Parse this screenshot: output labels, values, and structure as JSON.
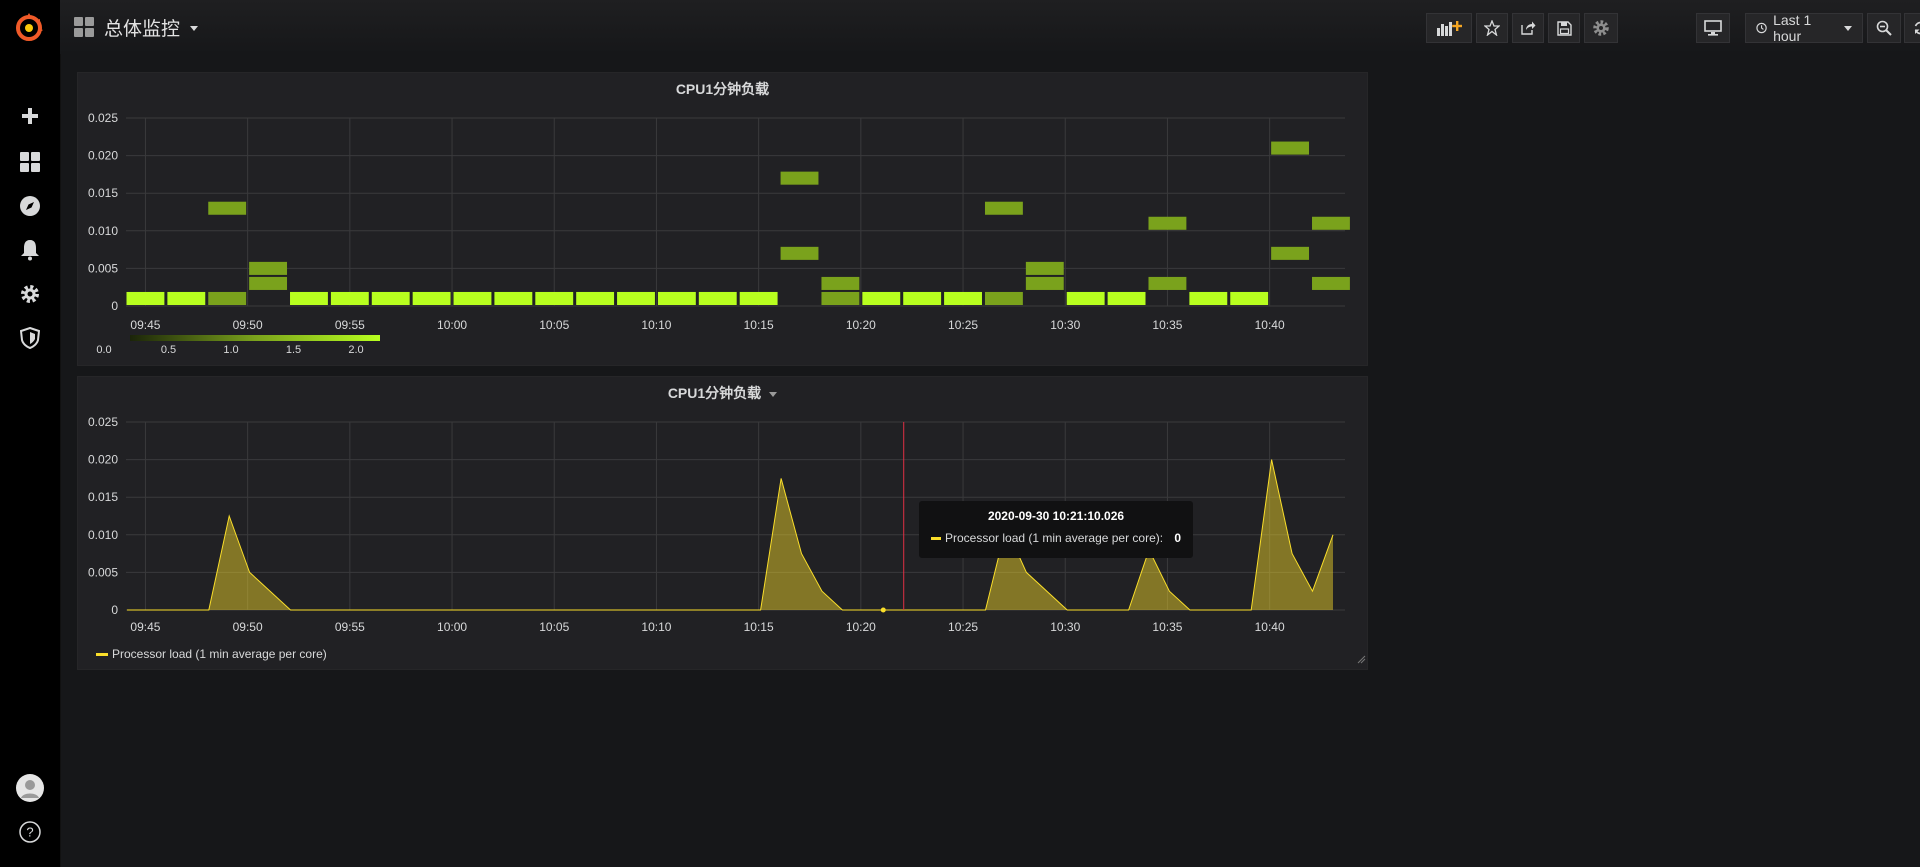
{
  "dashboard": {
    "title": "总体监控"
  },
  "navbar": {
    "time_picker_label": "Last 1 hour",
    "buttons": [
      "add-panel-icon",
      "star-icon",
      "share-icon",
      "save-icon",
      "gear-icon",
      "tv-mode-icon",
      "zoom-out-icon",
      "refresh-icon"
    ]
  },
  "sidemenu": {
    "items": [
      "grafana-logo",
      "plus-icon",
      "dashboards-icon",
      "explore-compass-icon",
      "bell-icon",
      "gear-icon",
      "shield-icon",
      "avatar",
      "help-icon"
    ]
  },
  "colors": {
    "accent": "#fade2a",
    "heat_high": "#b8ff1f",
    "heat_mid": "#7aa21c",
    "heat_low": "#57731e",
    "panel_bg": "#212124",
    "page_bg": "#161719"
  },
  "panels": [
    {
      "title": "CPU1分钟负载"
    },
    {
      "title": "CPU1分钟负载",
      "legend": "Processor load (1 min average per core)"
    }
  ],
  "tooltip": {
    "time": "2020-09-30 10:21:10.026",
    "series": "Processor load (1 min average per core):",
    "value": "0"
  },
  "chart_data": [
    {
      "type": "heatmap",
      "title": "CPU1分钟负载",
      "x_ticks": [
        "09:45",
        "09:50",
        "09:55",
        "10:00",
        "10:05",
        "10:10",
        "10:15",
        "10:20",
        "10:25",
        "10:30",
        "10:35",
        "10:40"
      ],
      "y_ticks": [
        "0.025",
        "0.020",
        "0.015",
        "0.010",
        "0.005",
        "0"
      ],
      "ylim": [
        0,
        0.025
      ],
      "bucket_size": 0.002,
      "legend_ticks": [
        "0.0",
        "0.5",
        "1.0",
        "1.5",
        "2.0"
      ],
      "color_range": [
        0,
        2
      ],
      "cells": [
        {
          "t": "09:44",
          "y": 0.001,
          "count": 2
        },
        {
          "t": "09:46",
          "y": 0.001,
          "count": 2
        },
        {
          "t": "09:48",
          "y": 0.001,
          "count": 1
        },
        {
          "t": "09:48",
          "y": 0.013,
          "count": 1
        },
        {
          "t": "09:50",
          "y": 0.003,
          "count": 1
        },
        {
          "t": "09:50",
          "y": 0.005,
          "count": 1
        },
        {
          "t": "09:52",
          "y": 0.001,
          "count": 2
        },
        {
          "t": "09:54",
          "y": 0.001,
          "count": 2
        },
        {
          "t": "09:56",
          "y": 0.001,
          "count": 2
        },
        {
          "t": "09:58",
          "y": 0.001,
          "count": 2
        },
        {
          "t": "10:00",
          "y": 0.001,
          "count": 2
        },
        {
          "t": "10:02",
          "y": 0.001,
          "count": 2
        },
        {
          "t": "10:04",
          "y": 0.001,
          "count": 2
        },
        {
          "t": "10:06",
          "y": 0.001,
          "count": 2
        },
        {
          "t": "10:08",
          "y": 0.001,
          "count": 2
        },
        {
          "t": "10:10",
          "y": 0.001,
          "count": 2
        },
        {
          "t": "10:12",
          "y": 0.001,
          "count": 2
        },
        {
          "t": "10:14",
          "y": 0.001,
          "count": 2
        },
        {
          "t": "10:16",
          "y": 0.007,
          "count": 1
        },
        {
          "t": "10:16",
          "y": 0.017,
          "count": 1
        },
        {
          "t": "10:18",
          "y": 0.001,
          "count": 1
        },
        {
          "t": "10:18",
          "y": 0.003,
          "count": 1
        },
        {
          "t": "10:20",
          "y": 0.001,
          "count": 2
        },
        {
          "t": "10:22",
          "y": 0.001,
          "count": 2
        },
        {
          "t": "10:24",
          "y": 0.001,
          "count": 2
        },
        {
          "t": "10:26",
          "y": 0.001,
          "count": 1
        },
        {
          "t": "10:26",
          "y": 0.013,
          "count": 1
        },
        {
          "t": "10:28",
          "y": 0.003,
          "count": 1
        },
        {
          "t": "10:28",
          "y": 0.005,
          "count": 1
        },
        {
          "t": "10:30",
          "y": 0.001,
          "count": 2
        },
        {
          "t": "10:32",
          "y": 0.001,
          "count": 2
        },
        {
          "t": "10:34",
          "y": 0.003,
          "count": 1
        },
        {
          "t": "10:34",
          "y": 0.011,
          "count": 1
        },
        {
          "t": "10:36",
          "y": 0.001,
          "count": 2
        },
        {
          "t": "10:38",
          "y": 0.001,
          "count": 2
        },
        {
          "t": "10:40",
          "y": 0.007,
          "count": 1
        },
        {
          "t": "10:40",
          "y": 0.021,
          "count": 1
        },
        {
          "t": "10:42",
          "y": 0.003,
          "count": 1
        },
        {
          "t": "10:42",
          "y": 0.011,
          "count": 1
        }
      ]
    },
    {
      "type": "area",
      "title": "CPU1分钟负载",
      "x_ticks": [
        "09:45",
        "09:50",
        "09:55",
        "10:00",
        "10:05",
        "10:10",
        "10:15",
        "10:20",
        "10:25",
        "10:30",
        "10:35",
        "10:40"
      ],
      "y_ticks": [
        "0.025",
        "0.020",
        "0.015",
        "0.010",
        "0.005",
        "0"
      ],
      "ylim": [
        0,
        0.025
      ],
      "grid": true,
      "legend_placement": "bottom-left",
      "series": [
        {
          "name": "Processor load (1 min average per core)",
          "x": [
            "09:44",
            "09:48",
            "09:49",
            "09:50",
            "09:52",
            "10:15",
            "10:16",
            "10:17",
            "10:18",
            "10:19",
            "10:20",
            "10:21",
            "10:25",
            "10:26",
            "10:27",
            "10:28",
            "10:30",
            "10:31",
            "10:33",
            "10:34",
            "10:35",
            "10:36",
            "10:39",
            "10:40",
            "10:41",
            "10:42",
            "10:43"
          ],
          "values": [
            0,
            0,
            0.0125,
            0.005,
            0,
            0,
            0.0175,
            0.0075,
            0.0025,
            0,
            0,
            0,
            0,
            0,
            0.011,
            0.005,
            0,
            0,
            0,
            0.008,
            0.0025,
            0,
            0,
            0.02,
            0.0075,
            0.0025,
            0.01
          ]
        }
      ],
      "cursor_time": "10:22"
    }
  ]
}
